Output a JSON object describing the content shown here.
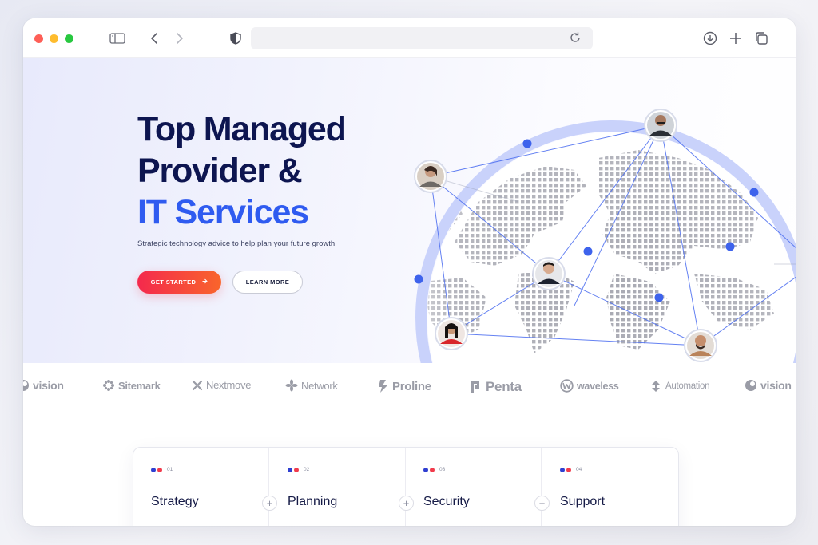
{
  "hero": {
    "title_line1": "Top Managed",
    "title_line2": "Provider &",
    "title_accent": "IT Services",
    "subtitle": "Strategic technology advice to help plan your future growth.",
    "primary_button": "GET STARTED",
    "secondary_button": "LEARN MORE"
  },
  "logos": [
    "vision",
    "Sitemark",
    "Nextmove",
    "Network",
    "Proline",
    "Penta",
    "waveless",
    "Automation",
    "vision"
  ],
  "services": [
    {
      "num": "01",
      "label": "Strategy"
    },
    {
      "num": "02",
      "label": "Planning"
    },
    {
      "num": "03",
      "label": "Security"
    },
    {
      "num": "04",
      "label": "Support"
    }
  ],
  "colors": {
    "title": "#0d1550",
    "accent": "#2f5bf0",
    "button_gradient_start": "#f4294d",
    "button_gradient_end": "#f9652b",
    "node_dot": "#3e63ec"
  }
}
